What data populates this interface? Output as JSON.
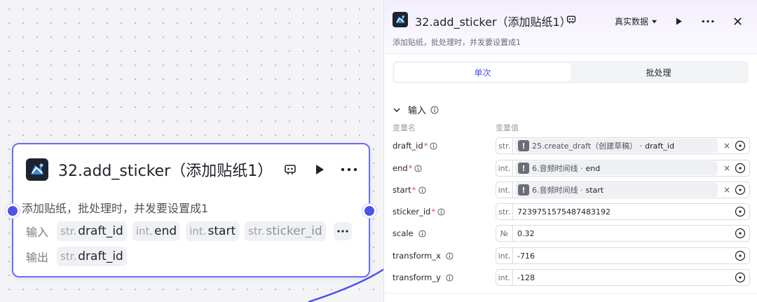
{
  "node": {
    "title": "32.add_sticker（添加贴纸1）",
    "description": "添加贴纸，批处理时，并发要设置成1",
    "input_label": "输入",
    "output_label": "输出",
    "inputs": [
      {
        "type": "str.",
        "name": "draft_id"
      },
      {
        "type": "int.",
        "name": "end"
      },
      {
        "type": "int.",
        "name": "start"
      },
      {
        "type": "str.",
        "name": "sticker_id"
      }
    ],
    "outputs": [
      {
        "type": "str.",
        "name": "draft_id"
      }
    ]
  },
  "panel": {
    "title": "32.add_sticker（添加贴纸1）",
    "description": "添加贴纸，批处理时，并发要设置成1",
    "data_mode": "真实数据",
    "tabs": [
      "单次",
      "批处理"
    ],
    "section_title": "输入",
    "col_name": "变量名",
    "col_value": "变量值",
    "params": [
      {
        "name": "draft_id",
        "required": "*",
        "type": "str.",
        "ref_source": "25.create_draft（创建草稿）",
        "ref_sep": "·",
        "ref_field": "draft_id"
      },
      {
        "name": "end",
        "required": "*",
        "type": "int.",
        "ref_source": "6.音频时间线",
        "ref_sep": "·",
        "ref_field": "end"
      },
      {
        "name": "start",
        "required": "*",
        "type": "int.",
        "ref_source": "6.音频时间线",
        "ref_sep": "·",
        "ref_field": "start"
      },
      {
        "name": "sticker_id",
        "required": "*",
        "type": "str.",
        "value": "7239751575487483192"
      },
      {
        "name": "scale",
        "type": "№",
        "value": "0.32"
      },
      {
        "name": "transform_x",
        "type": "int.",
        "value": "-716"
      },
      {
        "name": "transform_y",
        "type": "int.",
        "value": "-128"
      }
    ]
  }
}
